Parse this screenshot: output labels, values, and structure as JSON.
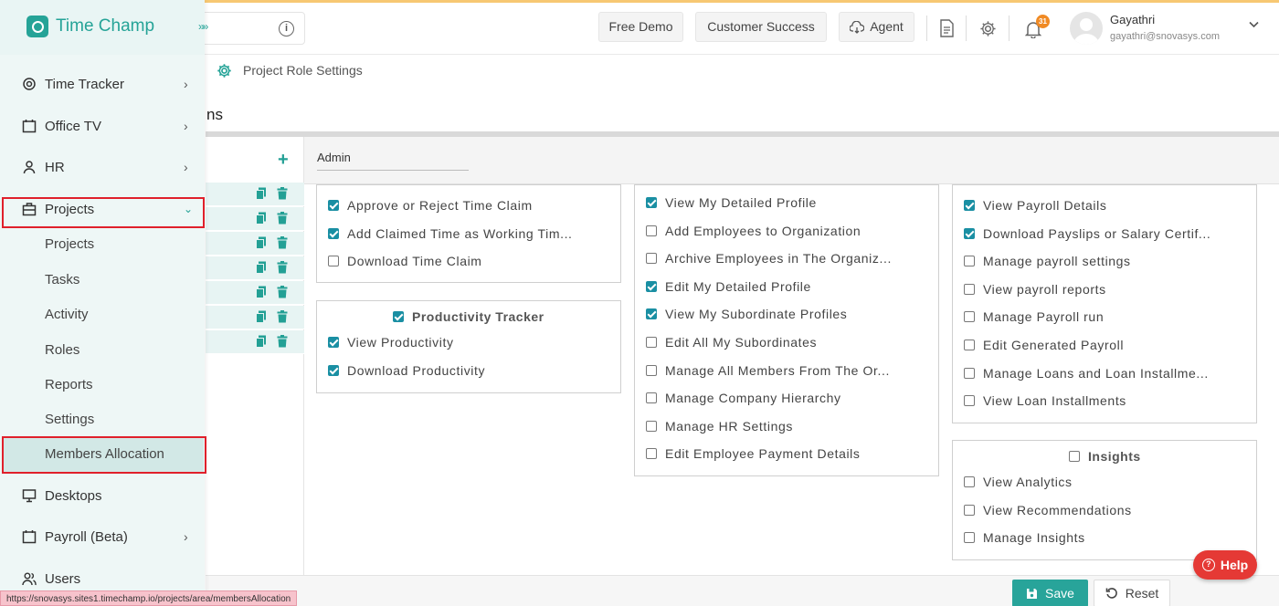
{
  "app": {
    "name": "Time Champ"
  },
  "topbar": {
    "buttons": {
      "free_demo": "Free Demo",
      "customer_success": "Customer Success",
      "agent": "Agent"
    },
    "notification_count": "31",
    "user": {
      "name": "Gayathri",
      "email": "gayathri@snovasys.com"
    }
  },
  "breadcrumb": {
    "label": "Project Role Settings"
  },
  "page": {
    "title_fragment": "ns"
  },
  "role": {
    "name": "Admin"
  },
  "sidebar": {
    "items": [
      {
        "label": "Time Tracker"
      },
      {
        "label": "Office TV"
      },
      {
        "label": "HR"
      },
      {
        "label": "Projects"
      },
      {
        "label": "Desktops"
      },
      {
        "label": "Payroll (Beta)"
      },
      {
        "label": "Users"
      }
    ],
    "projects_sub": [
      {
        "label": "Projects"
      },
      {
        "label": "Tasks"
      },
      {
        "label": "Activity"
      },
      {
        "label": "Roles"
      },
      {
        "label": "Reports"
      },
      {
        "label": "Settings"
      },
      {
        "label": "Members Allocation"
      }
    ]
  },
  "timeclaim_box": {
    "items": [
      {
        "label": "Approve  or  Reject  Time  Claim",
        "checked": true
      },
      {
        "label": "Add  Claimed  Time  as  Working  Tim...",
        "checked": true
      },
      {
        "label": "Download  Time  Claim",
        "checked": false
      }
    ]
  },
  "productivity_box": {
    "title": "Productivity  Tracker",
    "checked": true,
    "items": [
      {
        "label": "View  Productivity",
        "checked": true
      },
      {
        "label": "Download  Productivity",
        "checked": true
      }
    ]
  },
  "hr_box": {
    "items": [
      {
        "label": "View  My  Detailed  Profile",
        "checked": true
      },
      {
        "label": "Add  Employees  to  Organization",
        "checked": false
      },
      {
        "label": "Archive  Employees  in  The  Organiz...",
        "checked": false
      },
      {
        "label": "Edit  My  Detailed  Profile",
        "checked": true
      },
      {
        "label": "View  My  Subordinate  Profiles",
        "checked": true
      },
      {
        "label": "Edit  All  My  Subordinates",
        "checked": false
      },
      {
        "label": "Manage  All  Members  From  The  Or...",
        "checked": false
      },
      {
        "label": "Manage  Company  Hierarchy",
        "checked": false
      },
      {
        "label": "Manage  HR  Settings",
        "checked": false
      },
      {
        "label": "Edit  Employee  Payment  Details",
        "checked": false
      }
    ]
  },
  "payroll_box": {
    "items": [
      {
        "label": "View  Payroll  Details",
        "checked": true
      },
      {
        "label": "Download  Payslips  or  Salary  Certif...",
        "checked": true
      },
      {
        "label": "Manage  payroll  settings",
        "checked": false
      },
      {
        "label": "View  payroll  reports",
        "checked": false
      },
      {
        "label": "Manage  Payroll  run",
        "checked": false
      },
      {
        "label": "Edit  Generated  Payroll",
        "checked": false
      },
      {
        "label": "Manage  Loans  and  Loan  Installme...",
        "checked": false
      },
      {
        "label": "View  Loan  Installments",
        "checked": false
      }
    ]
  },
  "insights_box": {
    "title": "Insights",
    "checked": false,
    "items": [
      {
        "label": "View  Analytics",
        "checked": false
      },
      {
        "label": "View  Recommendations",
        "checked": false
      },
      {
        "label": "Manage  Insights",
        "checked": false
      }
    ]
  },
  "footer": {
    "save": "Save",
    "reset": "Reset",
    "help": "Help"
  },
  "status_url": "https://snovasys.sites1.timechamp.io/projects/area/membersAllocation",
  "colors": {
    "brand": "#25a397",
    "checkbox": "#1a8fa3",
    "highlight": "#e0202b",
    "help": "#e53935"
  }
}
